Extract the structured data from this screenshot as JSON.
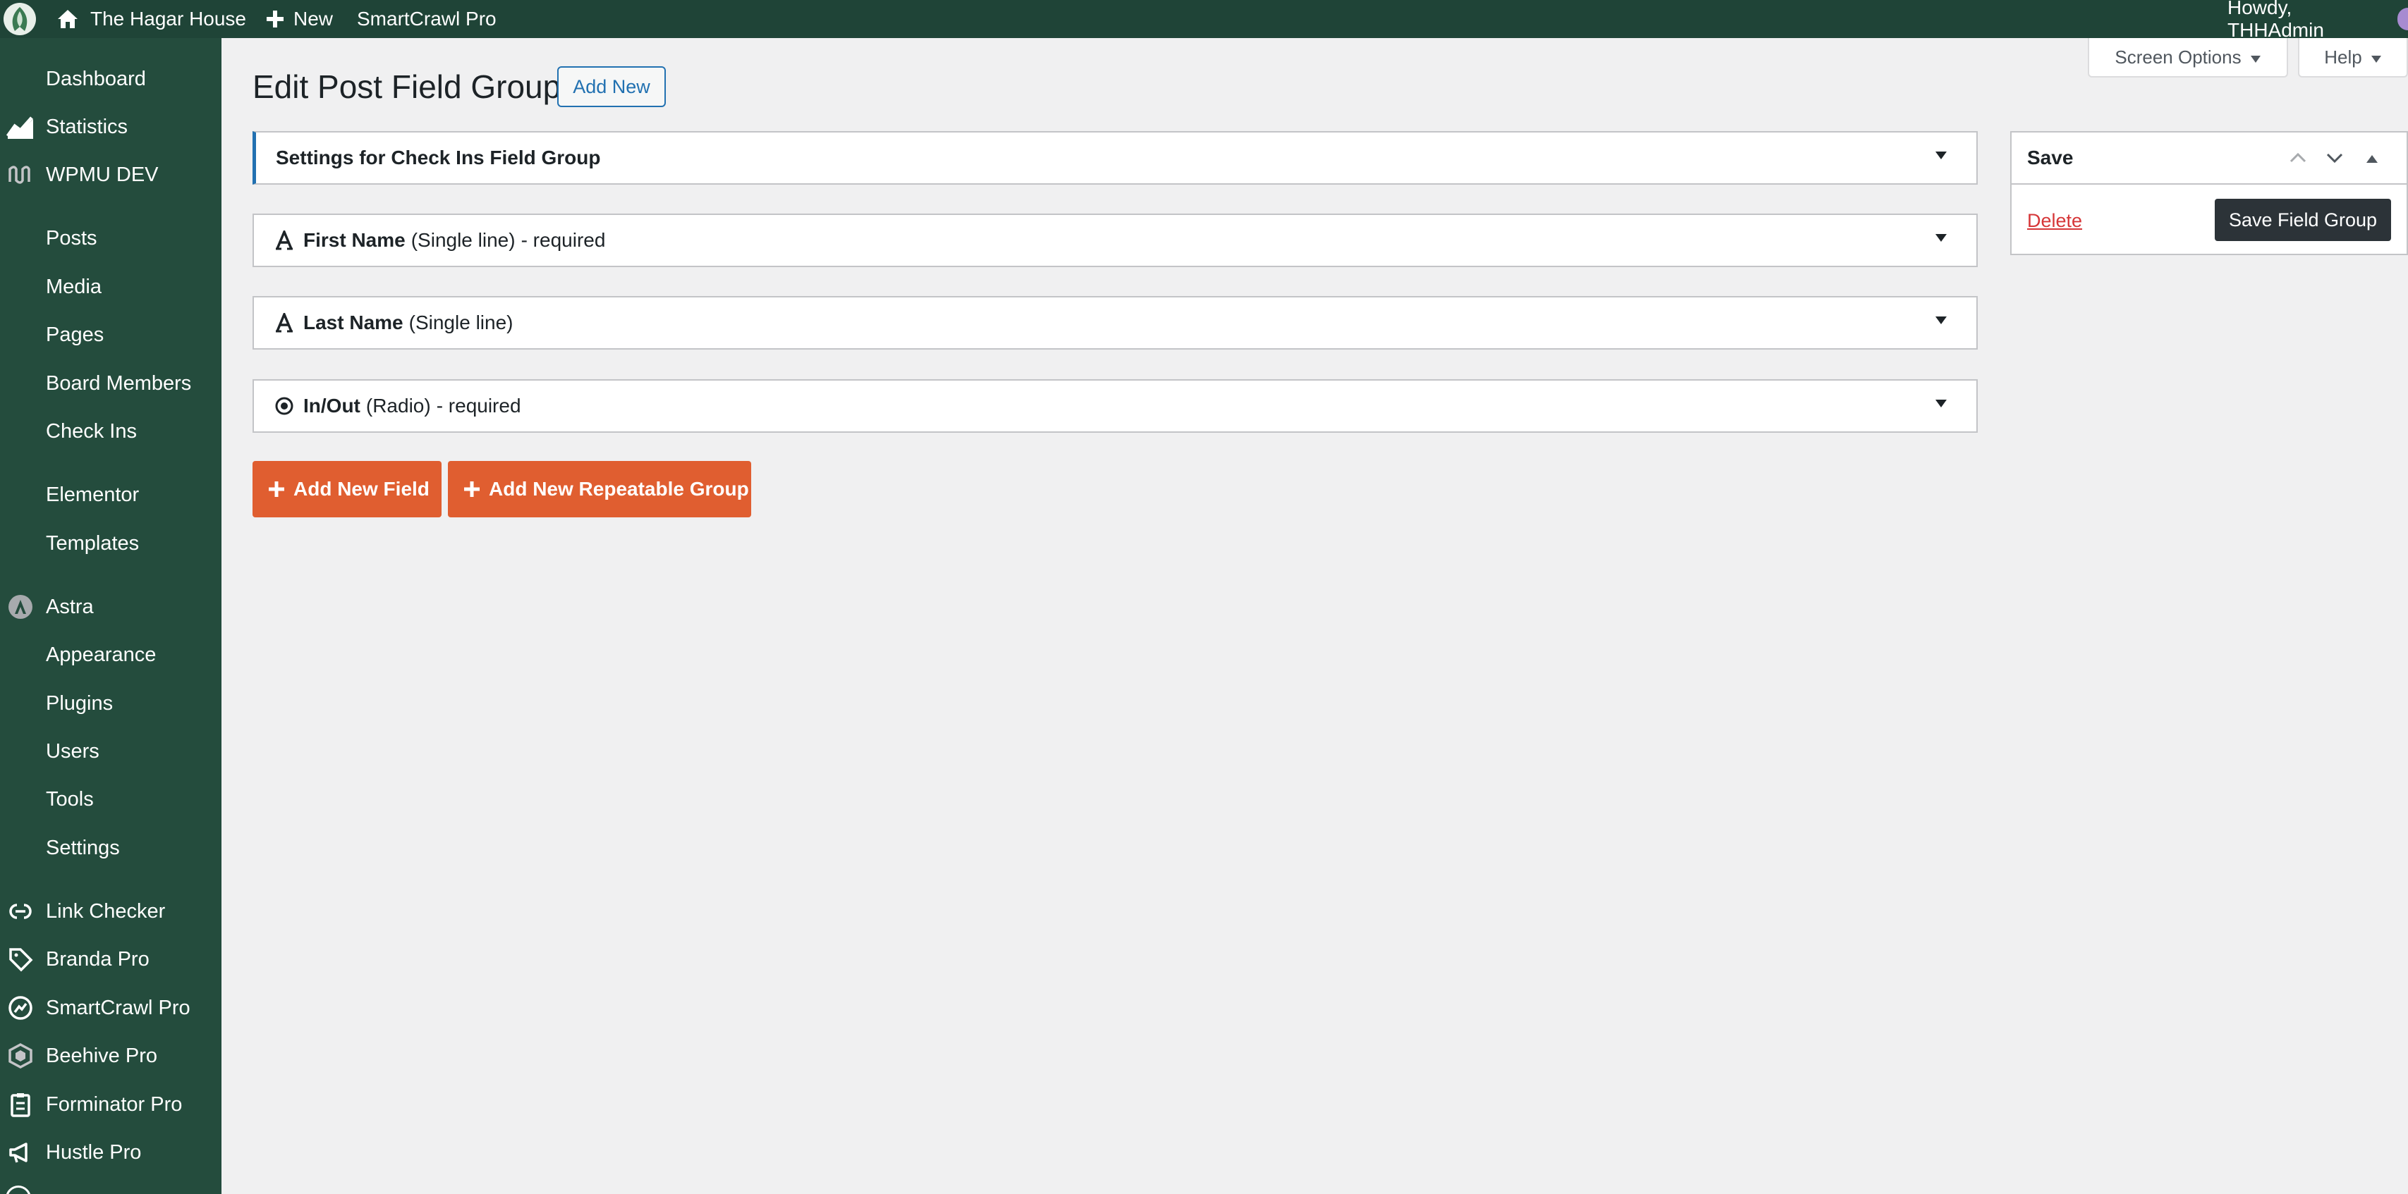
{
  "admin_bar": {
    "site_name": "The Hagar House",
    "new_label": "New",
    "plugin_link": "SmartCrawl Pro",
    "greeting": "Howdy, THHAdmin"
  },
  "sidebar": {
    "items": [
      {
        "label": "Dashboard",
        "icon": "dashboard-icon"
      },
      {
        "label": "Statistics",
        "icon": "statistics-icon"
      },
      {
        "label": "WPMU DEV",
        "icon": "wpmudev-icon"
      },
      {
        "label": "Posts",
        "icon": "posts-icon"
      },
      {
        "label": "Media",
        "icon": "media-icon"
      },
      {
        "label": "Pages",
        "icon": "pages-icon"
      },
      {
        "label": "Board Members",
        "icon": "board-members-icon"
      },
      {
        "label": "Check Ins",
        "icon": "check-ins-icon"
      },
      {
        "label": "Elementor",
        "icon": "elementor-icon"
      },
      {
        "label": "Templates",
        "icon": "templates-icon"
      },
      {
        "label": "Astra",
        "icon": "astra-icon"
      },
      {
        "label": "Appearance",
        "icon": "appearance-icon"
      },
      {
        "label": "Plugins",
        "icon": "plugins-icon"
      },
      {
        "label": "Users",
        "icon": "users-icon"
      },
      {
        "label": "Tools",
        "icon": "tools-icon"
      },
      {
        "label": "Settings",
        "icon": "settings-icon"
      },
      {
        "label": "Link Checker",
        "icon": "link-checker-icon"
      },
      {
        "label": "Branda Pro",
        "icon": "branda-icon"
      },
      {
        "label": "SmartCrawl Pro",
        "icon": "smartcrawl-icon"
      },
      {
        "label": "Beehive Pro",
        "icon": "beehive-icon"
      },
      {
        "label": "Forminator Pro",
        "icon": "forminator-icon"
      },
      {
        "label": "Hustle Pro",
        "icon": "hustle-icon"
      }
    ]
  },
  "screen_meta": {
    "screen_options": "Screen Options",
    "help": "Help"
  },
  "page": {
    "title": "Edit Post Field Group",
    "add_new": "Add New",
    "settings_panel": "Settings for Check Ins Field Group",
    "fields": [
      {
        "name": "First Name",
        "type": "(Single line)",
        "suffix": "- required",
        "icon": "single-line-text-icon"
      },
      {
        "name": "Last Name",
        "type": "(Single line)",
        "suffix": "",
        "icon": "single-line-text-icon"
      },
      {
        "name": "In/Out",
        "type": "(Radio)",
        "suffix": "- required",
        "icon": "radio-icon"
      }
    ],
    "add_field": "Add New Field",
    "add_repeatable_group": "Add New Repeatable Group"
  },
  "save_box": {
    "title": "Save",
    "delete": "Delete",
    "save_button": "Save Field Group"
  },
  "colors": {
    "admin_bar_bg": "#1f4437",
    "sidebar_bg": "#244c3d",
    "accent_orange": "#e05e30",
    "link_blue": "#2271b1",
    "delete_red": "#d63638"
  }
}
